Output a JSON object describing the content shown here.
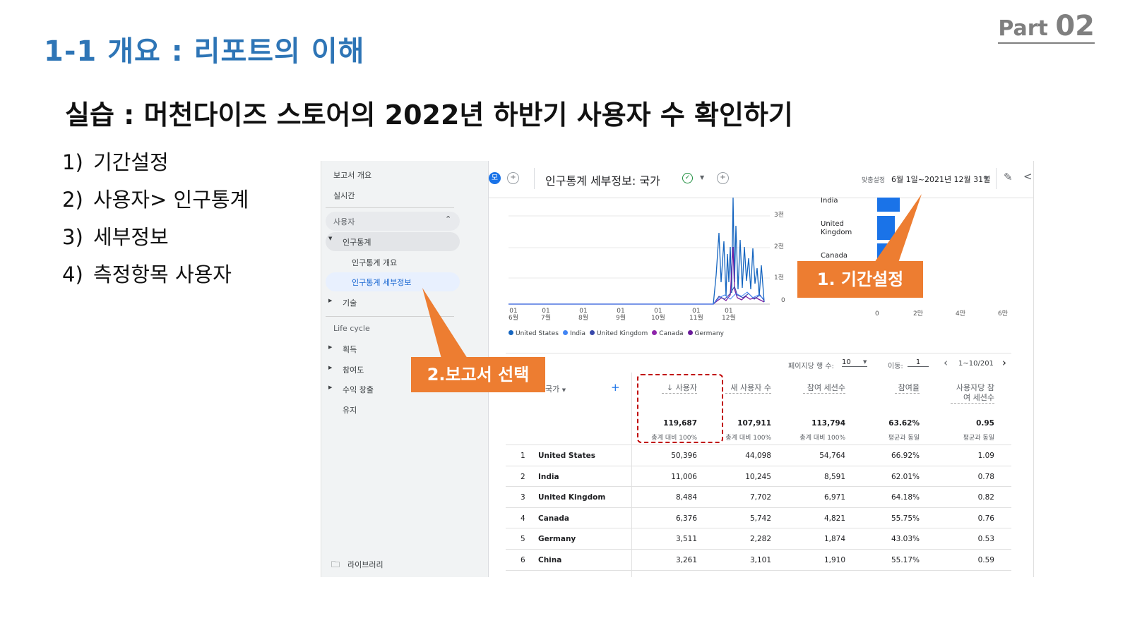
{
  "slide": {
    "title": "1-1 개요 : 리포트의 이해",
    "part_label": "Part",
    "part_number": "02",
    "subtitle": "실습 : 머천다이즈 스토어의 2022년 하반기 사용자 수 확인하기",
    "steps": [
      {
        "num": "1)",
        "text": "기간설정"
      },
      {
        "num": "2)",
        "text": "사용자> 인구통계"
      },
      {
        "num": "3)",
        "text": "세부정보"
      },
      {
        "num": "4)",
        "text": "측정항목 사용자"
      }
    ],
    "callout_period": "1. 기간설정",
    "callout_report": "2.보고서 선택"
  },
  "sidebar": {
    "report_overview": "보고서 개요",
    "realtime": "실시간",
    "users_section": "사용자",
    "demographics": "인구통계",
    "demographics_overview": "인구통계 개요",
    "demographics_detail": "인구통계 세부정보",
    "tech": "기술",
    "lifecycle": "Life cycle",
    "acquisition": "획득",
    "engagement": "참여도",
    "monetization": "수익 창출",
    "retention": "유지",
    "library": "라이브러리"
  },
  "topbar": {
    "badge": "모",
    "report_title": "인구통계 세부정보: 국가",
    "date_label": "맞춤설정",
    "date_range": "6월 1일~2021년 12월 31일"
  },
  "line_chart": {
    "y_ticks": [
      "3천",
      "2천",
      "1천",
      "0"
    ],
    "x_ticks": [
      [
        "01",
        "6월"
      ],
      [
        "01",
        "7월"
      ],
      [
        "01",
        "8월"
      ],
      [
        "01",
        "9월"
      ],
      [
        "01",
        "10월"
      ],
      [
        "01",
        "11월"
      ],
      [
        "01",
        "12월"
      ]
    ],
    "legend": [
      {
        "name": "United States",
        "color": "#1a73e8"
      },
      {
        "name": "India",
        "color": "#4285f4"
      },
      {
        "name": "United Kingdom",
        "color": "#3949ab"
      },
      {
        "name": "Canada",
        "color": "#8e24aa"
      },
      {
        "name": "Germany",
        "color": "#6a1b9a"
      }
    ]
  },
  "bar_chart": {
    "labels": [
      "India",
      "United Kingdom",
      "Canada"
    ],
    "x_ticks": [
      "0",
      "2만",
      "4만",
      "6만"
    ]
  },
  "table_controls": {
    "rows_per_page_label": "페이지당 행 수:",
    "rows_per_page": "10",
    "goto_label": "이동:",
    "goto_value": "1",
    "pager": "1~10/201"
  },
  "table": {
    "dimension_header": "국가",
    "columns": [
      "↓ 사용자",
      "새 사용자 수",
      "참여 세션수",
      "참여율",
      "사용자당 참여 세션수"
    ],
    "totals": [
      "119,687",
      "107,911",
      "113,794",
      "63.62%",
      "0.95"
    ],
    "totals_sub": [
      "총계 대비 100%",
      "총계 대비 100%",
      "총계 대비 100%",
      "평균과 동일",
      "평균과 동일"
    ],
    "rows": [
      {
        "rank": "1",
        "country": "United States",
        "values": [
          "50,396",
          "44,098",
          "54,764",
          "66.92%",
          "1.09"
        ]
      },
      {
        "rank": "2",
        "country": "India",
        "values": [
          "11,006",
          "10,245",
          "8,591",
          "62.01%",
          "0.78"
        ]
      },
      {
        "rank": "3",
        "country": "United Kingdom",
        "values": [
          "8,484",
          "7,702",
          "6,971",
          "64.18%",
          "0.82"
        ]
      },
      {
        "rank": "4",
        "country": "Canada",
        "values": [
          "6,376",
          "5,742",
          "4,821",
          "55.75%",
          "0.76"
        ]
      },
      {
        "rank": "5",
        "country": "Germany",
        "values": [
          "3,511",
          "2,282",
          "1,874",
          "43.03%",
          "0.53"
        ]
      },
      {
        "rank": "6",
        "country": "China",
        "values": [
          "3,261",
          "3,101",
          "1,910",
          "55.17%",
          "0.59"
        ]
      }
    ]
  }
}
